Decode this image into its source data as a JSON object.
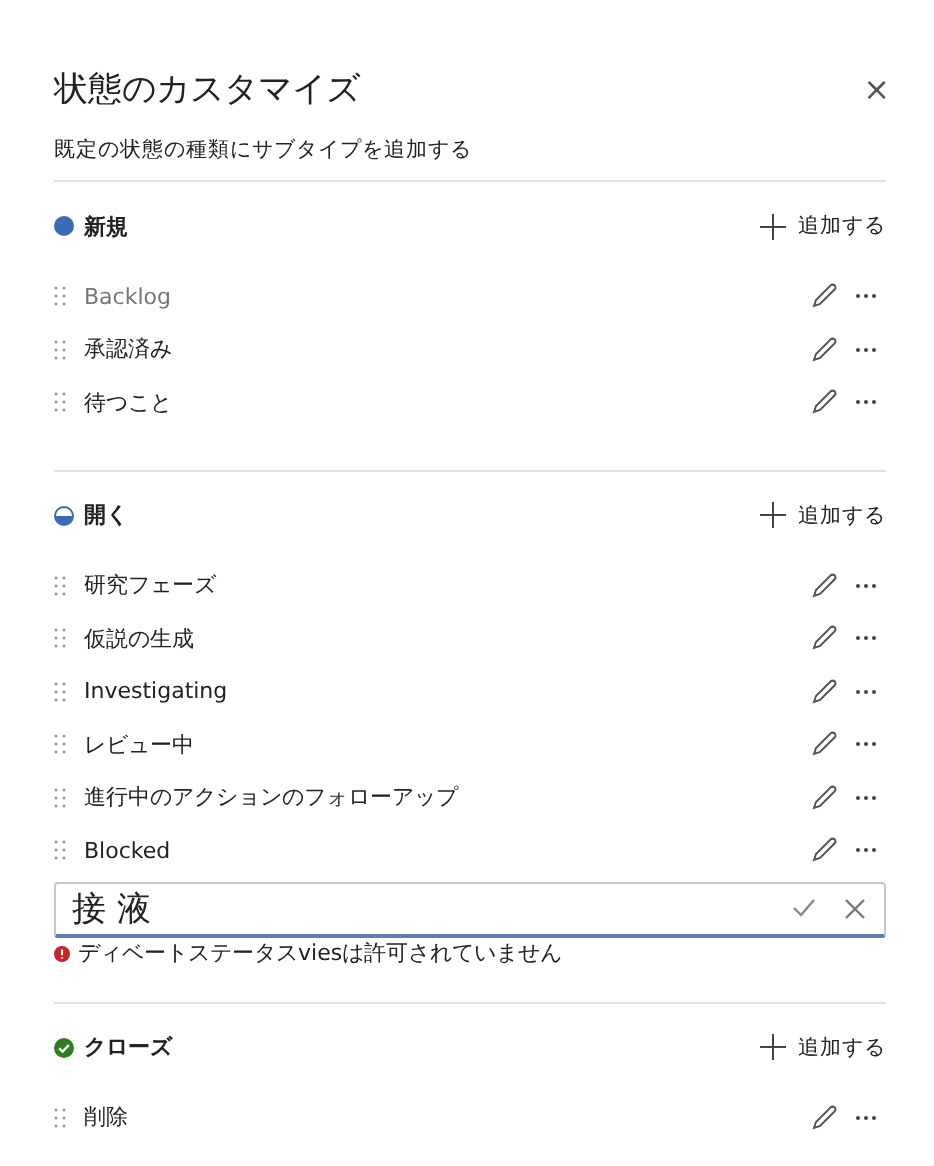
{
  "panel": {
    "title": "状態のカスタマイズ",
    "close": "×",
    "subtitle": "既定の状態の種類にサブタイプを追加する"
  },
  "sections": [
    {
      "kind": "new",
      "name": "新規",
      "add_label": "追加する",
      "items": [
        {
          "label": "Backlog",
          "muted": true
        },
        {
          "label": "承認済み",
          "muted": false
        },
        {
          "label": "待つこと",
          "muted": false
        }
      ]
    },
    {
      "kind": "open",
      "name": "開く",
      "add_label": "追加する",
      "items": [
        {
          "label": "研究フェーズ",
          "muted": false
        },
        {
          "label": "仮説の生成",
          "muted": false
        },
        {
          "label": "Investigating",
          "muted": false
        },
        {
          "label": "レビュー中",
          "muted": false
        },
        {
          "label": "進行中のアクションのフォローアップ",
          "muted": false
        },
        {
          "label": "Blocked",
          "muted": false
        }
      ],
      "editor": {
        "value": "接 液",
        "error": "ディベートステータスviesは許可されていません"
      }
    },
    {
      "kind": "closed",
      "name": "クローズ",
      "add_label": "追加する",
      "items": [
        {
          "label": "削除",
          "muted": false
        }
      ]
    }
  ]
}
